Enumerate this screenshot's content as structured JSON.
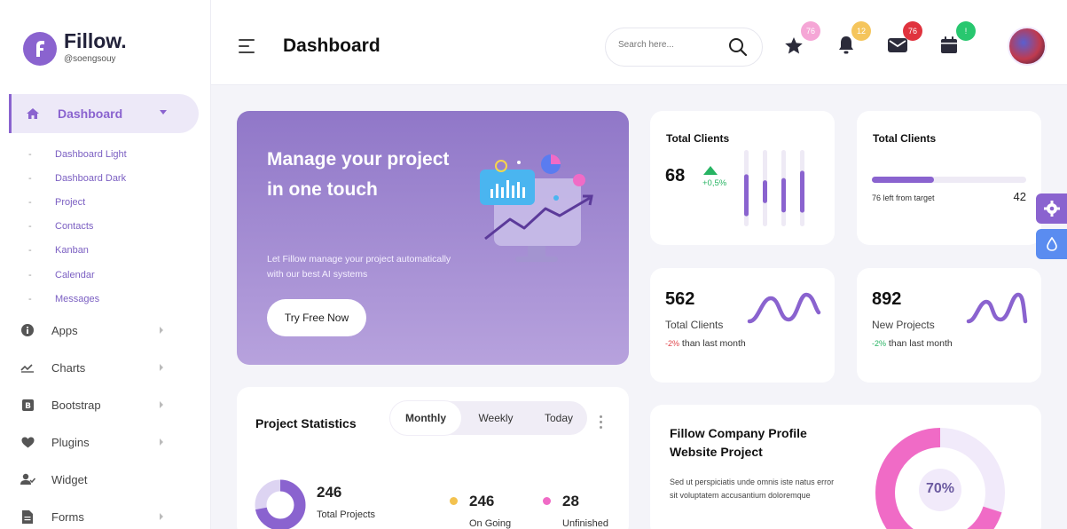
{
  "brand": {
    "name": "Fillow.",
    "handle": "@soengsouy"
  },
  "sidebar": {
    "active": {
      "label": "Dashboard"
    },
    "subitems": [
      "Dashboard Light",
      "Dashboard Dark",
      "Project",
      "Contacts",
      "Kanban",
      "Calendar",
      "Messages"
    ],
    "items": [
      {
        "label": "Apps",
        "icon": "info-icon"
      },
      {
        "label": "Charts",
        "icon": "chart-icon"
      },
      {
        "label": "Bootstrap",
        "icon": "bootstrap-icon"
      },
      {
        "label": "Plugins",
        "icon": "heart-icon"
      },
      {
        "label": "Widget",
        "icon": "user-check-icon"
      },
      {
        "label": "Forms",
        "icon": "file-icon"
      }
    ]
  },
  "header": {
    "title": "Dashboard",
    "search_placeholder": "Search here...",
    "badges": {
      "favorites": "76",
      "notifications": "12",
      "messages": "76",
      "calendar": "!"
    }
  },
  "banner": {
    "title": "Manage your project in one touch",
    "text": "Let Fillow manage your project automatically with our best AI systems",
    "button": "Try Free Now"
  },
  "card_total_clients": {
    "title": "Total Clients",
    "value": "68",
    "change": "+0,5%",
    "bars": [
      0.55,
      0.3,
      0.45,
      0.55
    ]
  },
  "card_target": {
    "title": "Total Clients",
    "caption": "76 left from target",
    "value": "42",
    "progress": 0.4
  },
  "card_clients": {
    "value": "562",
    "label": "Total Clients",
    "change": "-2%",
    "suffix": " than last month"
  },
  "card_projects": {
    "value": "892",
    "label": "New Projects",
    "change": "-2%",
    "suffix": " than last month"
  },
  "project_stats": {
    "title": "Project Statistics",
    "tabs": [
      "Monthly",
      "Weekly",
      "Today"
    ],
    "total": {
      "value": "246",
      "label": "Total Projects"
    },
    "ongoing": {
      "value": "246",
      "label": "On Going"
    },
    "unfinished": {
      "value": "28",
      "label": "Unfinished"
    }
  },
  "profile": {
    "title": "Fillow Company Profile Website Project",
    "text": "Sed ut perspiciatis unde omnis iste natus error sit voluptatem accusantium doloremque",
    "percent": "70%",
    "percent_value": 0.7
  },
  "colors": {
    "accent": "#8a63cf",
    "pink": "#f06bc6",
    "yellow": "#f3c24f",
    "red": "#e0454b",
    "green": "#28c76f"
  }
}
